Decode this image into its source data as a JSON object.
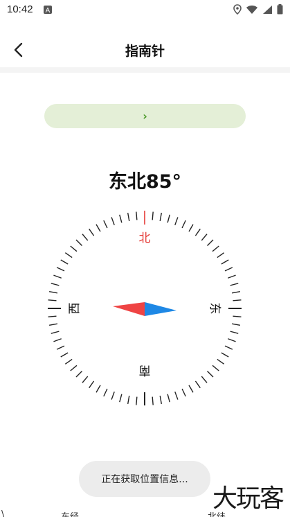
{
  "status_bar": {
    "time": "10:42",
    "icons": [
      "app-notification-icon",
      "location-icon",
      "wifi-icon",
      "signal-icon",
      "battery-icon"
    ]
  },
  "header": {
    "back_icon": "chevron-left-icon",
    "title": "指南针"
  },
  "banner": {
    "arrow": "›",
    "background": "#e4efd7",
    "arrow_color": "#4c9a2a"
  },
  "heading": {
    "direction": "东北85°"
  },
  "compass": {
    "labels": {
      "north": "北",
      "south": "南",
      "east": "东",
      "west": "西"
    },
    "north_color": "#e53935",
    "needle_red": "#ef4444",
    "needle_blue": "#1e88e5",
    "tick_color": "#222222",
    "heading_degrees": 85
  },
  "toast": {
    "text": "正在获取位置信息..."
  },
  "bottom": {
    "longitude_label": "东经",
    "latitude_label": "北纬",
    "left_mark": "\\"
  },
  "watermark": {
    "text": "大玩客"
  }
}
